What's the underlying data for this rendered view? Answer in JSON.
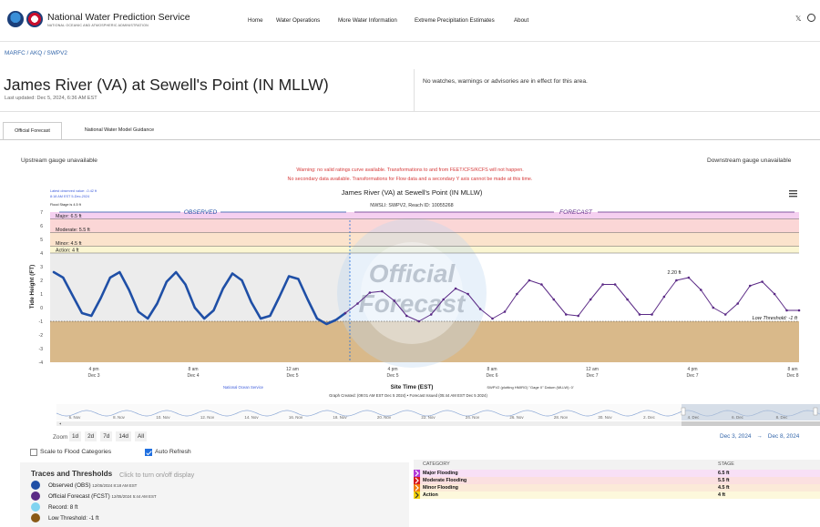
{
  "header": {
    "brand_title": "National Water Prediction Service",
    "brand_subtitle": "NATIONAL OCEANIC AND ATMOSPHERIC ADMINISTRATION",
    "nav": [
      "Home",
      "Water Operations",
      "More Water Information",
      "Extreme Precipitation Estimates",
      "About"
    ],
    "x_icon": "x-icon",
    "github_icon": "github-icon"
  },
  "breadcrumb": "MARFC / AKQ / SWPV2",
  "site": {
    "title": "James River (VA) at Sewell's Point (IN MLLW)",
    "updated": "Last updated: Dec 5, 2024, 6:36 AM EST",
    "advisory": "No watches, warnings or advisories are in effect for this area."
  },
  "tabs": [
    "Official Forecast",
    "National Water Model Guidance"
  ],
  "gauges": {
    "upstream": "Upstream gauge unavailable",
    "downstream": "Downstream gauge unavailable"
  },
  "warnings": [
    "Warning: no valid ratings curve available. Transformations to and from FEET/CFS/KCFS will not happen.",
    "No secondary data available. Transformations for Flow data and a secondary Y axis cannot be made at this time."
  ],
  "chart_text": {
    "latest_obs_line1": "Latest observed value: -0.42 ft",
    "latest_obs_line2": "8:18 AM EST 5-Dec-2024",
    "flood_stage": "Flood Stage is 4.5 ft",
    "title": "James River (VA) at Sewell's Point (IN MLLW)",
    "subtitle": "NWSLI: SWPV2, Reach ID: 10055268",
    "observed": "OBSERVED",
    "forecast": "FORECAST",
    "watermark1": "Official",
    "watermark2": "Forecast",
    "ylabel": "Tide Height (FT)",
    "xlabel": "Site Time (EST)",
    "source_left": "National Ocean Service",
    "source_right": "SWPV2 (plotting HMIRG) \"Gage 0\" Datum (MLLW): 0'",
    "created": "Graph Created: (09:01 AM EST Dec 5 2024) • Forecast Issued (05:44 AM EST Dec 5 2024)",
    "peak_label": "2.20 ft",
    "low_threshold_label": "Low Threshold: -1 ft",
    "menu_icon": "hamburger-menu-icon"
  },
  "chart_data": {
    "type": "line",
    "title": "James River (VA) at Sewell's Point (IN MLLW)",
    "xlabel": "Site Time (EST)",
    "ylabel": "Tide Height (FT)",
    "ylim": [
      -4,
      7
    ],
    "y_ticks": [
      "7",
      "6",
      "5",
      "4",
      "3",
      "2",
      "1",
      "0",
      "-1",
      "-2",
      "-3",
      "-4"
    ],
    "x_ticks": [
      {
        "label": "4 pm",
        "sub": "Dec 3"
      },
      {
        "label": "8 am",
        "sub": "Dec 4"
      },
      {
        "label": "12 am",
        "sub": "Dec 5"
      },
      {
        "label": "4 pm",
        "sub": "Dec 5"
      },
      {
        "label": "8 am",
        "sub": "Dec 6"
      },
      {
        "label": "12 am",
        "sub": "Dec 7"
      },
      {
        "label": "4 pm",
        "sub": "Dec 7"
      },
      {
        "label": "8 am",
        "sub": "Dec 8"
      }
    ],
    "thresholds": [
      {
        "label": "Major: 6.5 ft",
        "value": 6.5,
        "color": "#f5d0f0"
      },
      {
        "label": "Moderate: 5.5 ft",
        "value": 5.5,
        "color": "#fbd6d6"
      },
      {
        "label": "Minor: 4.5 ft",
        "value": 4.5,
        "color": "#fbe3cc"
      },
      {
        "label": "Action: 4 ft",
        "value": 4,
        "color": "#fbf6d2"
      }
    ],
    "low_threshold": -1,
    "series": [
      {
        "name": "Observed (OBS)",
        "color": "#1f4fa6",
        "y_range": "Dec 3 12 pm – Dec 5 8:18 am",
        "values": [
          2.6,
          2.2,
          0.9,
          -0.4,
          -0.6,
          0.7,
          2.2,
          2.6,
          1.3,
          -0.3,
          -0.8,
          0.3,
          1.9,
          2.6,
          1.7,
          0.0,
          -0.8,
          -0.2,
          1.4,
          2.5,
          2.0,
          0.4,
          -0.8,
          -0.6,
          0.8,
          2.3,
          2.1,
          0.6,
          -0.8,
          -1.2,
          -0.9,
          -0.4
        ]
      },
      {
        "name": "Official Forecast (FCST)",
        "color": "#5b2a86",
        "values": [
          -0.4,
          0.3,
          1.1,
          1.2,
          0.5,
          -0.6,
          -1.0,
          -0.5,
          0.6,
          1.4,
          1.0,
          -0.1,
          -0.8,
          -0.3,
          1.0,
          2.0,
          1.7,
          0.6,
          -0.5,
          -0.6,
          0.6,
          1.7,
          1.7,
          0.6,
          -0.5,
          -0.5,
          0.8,
          2.0,
          2.2,
          1.3,
          0.0,
          -0.5,
          0.3,
          1.6,
          1.9,
          1.0,
          -0.2,
          -0.2
        ]
      }
    ]
  },
  "navigator": {
    "dates": [
      "6. Nov",
      "8. Nov",
      "10. Nov",
      "12. Nov",
      "14. Nov",
      "16. Nov",
      "18. Nov",
      "20. Nov",
      "22. Nov",
      "24. Nov",
      "26. Nov",
      "28. Nov",
      "30. Nov",
      "2. Dec",
      "4. Dec",
      "6. Dec",
      "8. Dec"
    ]
  },
  "zoom": {
    "label": "Zoom",
    "buttons": [
      "1d",
      "2d",
      "7d",
      "14d",
      "All"
    ],
    "range_from": "Dec 3, 2024",
    "range_sep": "→",
    "range_to": "Dec 8, 2024"
  },
  "options": {
    "scale": "Scale to Flood Categories",
    "refresh": "Auto Refresh"
  },
  "legend": {
    "title": "Traces and Thresholds",
    "hint": "Click to turn on/off display",
    "items": [
      {
        "text": "Observed (OBS)",
        "sub": "12/05/2024 8:18 AM EST",
        "color": "#1f4fa6"
      },
      {
        "text": "Official Forecast (FCST)",
        "sub": "12/05/2024 5:44 AM EST",
        "color": "#5b2a86"
      },
      {
        "text": "Record: 8 ft",
        "sub": "",
        "color": "#7fd3f0"
      },
      {
        "text": "Low Threshold: -1 ft",
        "sub": "",
        "color": "#8a5a17"
      }
    ]
  },
  "categories": {
    "head_category": "CATEGORY",
    "head_stage": "STAGE",
    "rows": [
      {
        "name": "Major Flooding",
        "stage": "6.5 ft",
        "bg": "#f8e0f6",
        "chev": "#b13ad8"
      },
      {
        "name": "Moderate Flooding",
        "stage": "5.5 ft",
        "bg": "#fbe0e0",
        "chev": "#d81b1b"
      },
      {
        "name": "Minor Flooding",
        "stage": "4.5 ft",
        "bg": "#fbead8",
        "chev": "#f07d0a"
      },
      {
        "name": "Action",
        "stage": "4 ft",
        "bg": "#fdf8dc",
        "chev": "#f3d20a"
      }
    ]
  }
}
